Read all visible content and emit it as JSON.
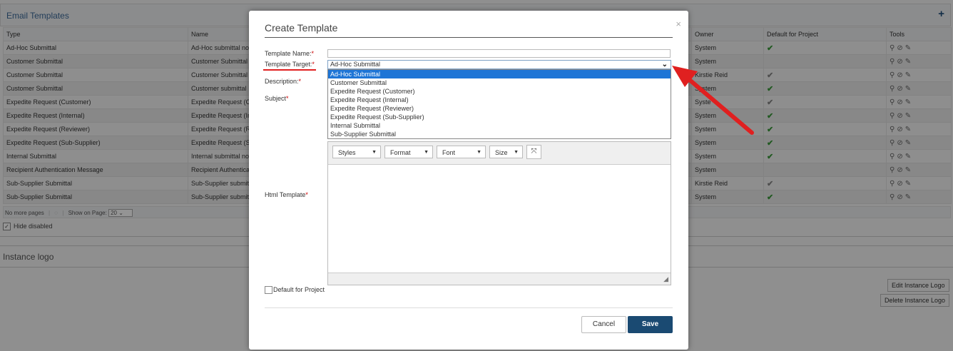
{
  "background": {
    "panel_title": "Email Templates",
    "add_icon": "plus-icon",
    "columns": [
      "Type",
      "Name",
      "Owner",
      "Default for Project",
      "Tools"
    ],
    "rows": [
      {
        "type": "Ad-Hoc Submittal",
        "name": "Ad-Hoc submittal no",
        "owner": "System",
        "default": "green"
      },
      {
        "type": "Customer Submittal",
        "name": "Customer Submittal",
        "owner": "System",
        "default": ""
      },
      {
        "type": "Customer Submittal",
        "name": "Customer Submittal",
        "owner": "Kirstie Reid",
        "default": "grey"
      },
      {
        "type": "Customer Submittal",
        "name": "Customer submittal",
        "owner": "System",
        "default": "green"
      },
      {
        "type": "Expedite Request (Customer)",
        "name": "Expedite Request (Cu",
        "owner": "Syste",
        "default": "grey"
      },
      {
        "type": "Expedite Request (Internal)",
        "name": "Expedite Request (In",
        "owner": "System",
        "default": "green"
      },
      {
        "type": "Expedite Request (Reviewer)",
        "name": "Expedite Request (Re",
        "owner": "System",
        "default": "green"
      },
      {
        "type": "Expedite Request (Sub-Supplier)",
        "name": "Expedite Request (Su",
        "owner": "System",
        "default": "green"
      },
      {
        "type": "Internal Submittal",
        "name": "Internal submittal no",
        "owner": "System",
        "default": "green"
      },
      {
        "type": "Recipient Authentication Message",
        "name": "Recipient Authentica",
        "owner": "System",
        "default": ""
      },
      {
        "type": "Sub-Supplier Submittal",
        "name": "Sub-Supplier submitt",
        "owner": "Kirstie Reid",
        "default": "grey"
      },
      {
        "type": "Sub-Supplier Submittal",
        "name": "Sub-Supplier submitt",
        "owner": "System",
        "default": "green"
      }
    ],
    "pager": {
      "no_more": "No more pages",
      "show_label": "Show on Page:",
      "page_size": "20"
    },
    "hide_disabled": "Hide disabled",
    "instance_logo_title": "Instance logo",
    "edit_logo": "Edit Instance Logo",
    "delete_logo": "Delete Instance Logo"
  },
  "modal": {
    "title": "Create Template",
    "close": "×",
    "template_name_label": "Template Name:",
    "template_target_label": "Template Target:",
    "description_label": "Description:",
    "subject_label": "Subject",
    "html_template_label": "Html Template",
    "required_mark": "*",
    "selected_target": "Ad-Hoc Submittal",
    "target_options": [
      "Ad-Hoc Submittal",
      "Customer Submittal",
      "Expedite Request (Customer)",
      "Expedite Request (Internal)",
      "Expedite Request (Reviewer)",
      "Expedite Request (Sub-Supplier)",
      "Internal Submittal",
      "Sub-Supplier Submittal"
    ],
    "editor_toolbar": {
      "styles": "Styles",
      "format": "Format",
      "font": "Font",
      "size": "Size"
    },
    "default_for_project": "Default for Project",
    "cancel": "Cancel",
    "save": "Save"
  },
  "colors": {
    "accent": "#1a4a72",
    "selected_option": "#1e75d6",
    "annotation": "#e02020",
    "check": "#3a9a3a"
  }
}
